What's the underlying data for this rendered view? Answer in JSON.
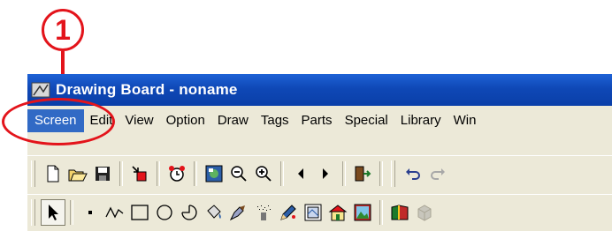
{
  "annotation": {
    "step_number": "1"
  },
  "window": {
    "title": "Drawing Board - noname"
  },
  "menu": {
    "items": [
      {
        "label": "Screen",
        "active": true
      },
      {
        "label": "Edit"
      },
      {
        "label": "View"
      },
      {
        "label": "Option"
      },
      {
        "label": "Draw"
      },
      {
        "label": "Tags"
      },
      {
        "label": "Parts"
      },
      {
        "label": "Special"
      },
      {
        "label": "Library"
      },
      {
        "label": "Win"
      }
    ]
  },
  "toolbar1": {
    "icons": [
      "new-document-icon",
      "open-folder-icon",
      "save-icon",
      "export-icon",
      "alarm-clock-icon",
      "screen-image-icon",
      "zoom-out-icon",
      "zoom-in-icon",
      "previous-page-icon",
      "next-page-icon",
      "exit-door-icon",
      "undo-icon",
      "redo-icon"
    ]
  },
  "toolbar2": {
    "icons": [
      "select-pointer-icon",
      "dot-tool-icon",
      "polyline-tool-icon",
      "rectangle-tool-icon",
      "circle-tool-icon",
      "arc-tool-icon",
      "paint-bucket-icon",
      "paint-brush-icon",
      "spray-icon",
      "pen-icon",
      "picture-frame-icon",
      "building-icon",
      "landscape-icon",
      "book-icon",
      "cube-icon"
    ]
  },
  "colors": {
    "accent": "#316ac5",
    "annotation": "#e3141b",
    "titlebar": "#0f48b6",
    "chrome": "#ece9d8"
  }
}
